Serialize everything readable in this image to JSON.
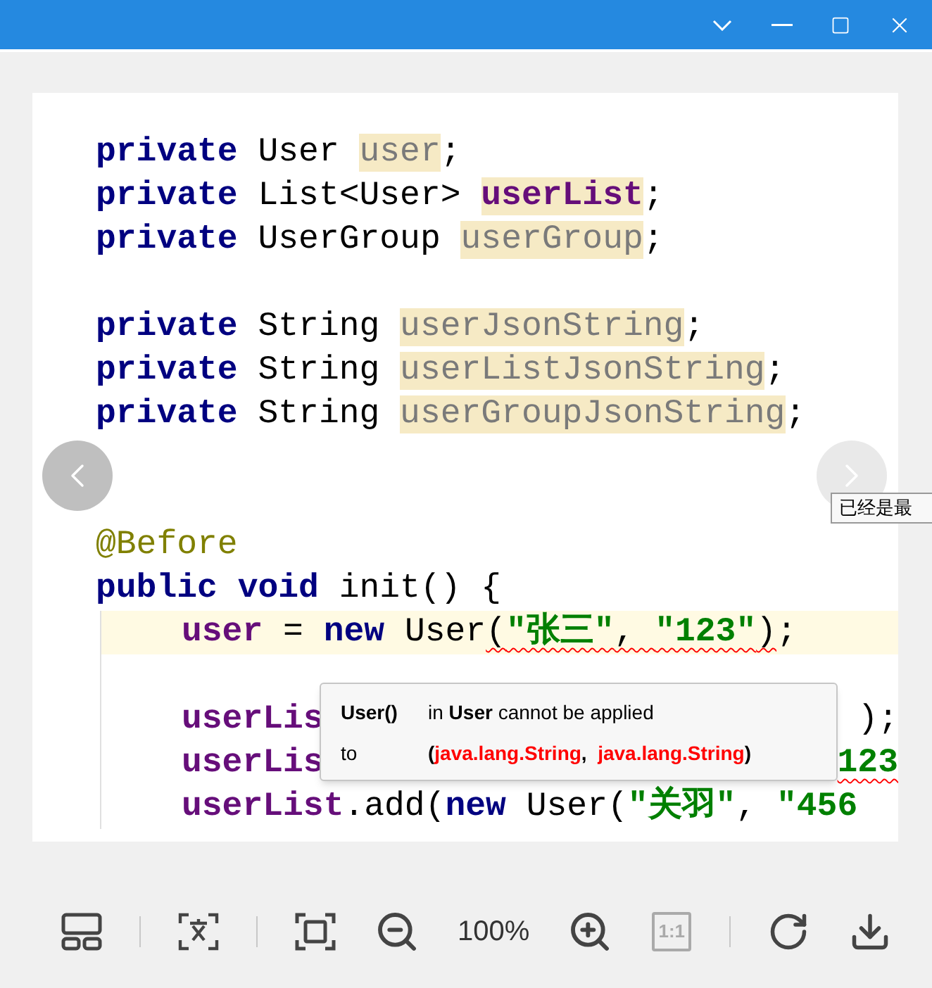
{
  "title_bar": {
    "buttons": [
      {
        "kind": "dropdown"
      },
      {
        "kind": "minimize"
      },
      {
        "kind": "maximize"
      },
      {
        "kind": "close"
      }
    ]
  },
  "code": {
    "lines": [
      {
        "tokens": [
          {
            "text": "private",
            "kind": "keyword"
          },
          {
            "text": " User ",
            "kind": "plain"
          },
          {
            "text": "user",
            "kind": "unused_field"
          },
          {
            "text": ";",
            "kind": "plain"
          }
        ]
      },
      {
        "tokens": [
          {
            "text": "private",
            "kind": "keyword"
          },
          {
            "text": " List<User> ",
            "kind": "plain"
          },
          {
            "text": "userList",
            "kind": "field_decl"
          },
          {
            "text": ";",
            "kind": "plain"
          }
        ]
      },
      {
        "tokens": [
          {
            "text": "private",
            "kind": "keyword"
          },
          {
            "text": " UserGroup ",
            "kind": "plain"
          },
          {
            "text": "userGroup",
            "kind": "unused_field"
          },
          {
            "text": ";",
            "kind": "plain"
          }
        ]
      },
      {
        "kind": "blank"
      },
      {
        "tokens": [
          {
            "text": "private",
            "kind": "keyword"
          },
          {
            "text": " String ",
            "kind": "plain"
          },
          {
            "text": "userJsonString",
            "kind": "unused_field"
          },
          {
            "text": ";",
            "kind": "plain"
          }
        ]
      },
      {
        "tokens": [
          {
            "text": "private",
            "kind": "keyword"
          },
          {
            "text": " String ",
            "kind": "plain"
          },
          {
            "text": "userListJsonString",
            "kind": "unused_field"
          },
          {
            "text": ";",
            "kind": "plain"
          }
        ]
      },
      {
        "tokens": [
          {
            "text": "private",
            "kind": "keyword"
          },
          {
            "text": " String ",
            "kind": "plain"
          },
          {
            "text": "userGroupJsonString",
            "kind": "unused_field"
          },
          {
            "text": ";",
            "kind": "plain"
          }
        ]
      },
      {
        "kind": "blank"
      },
      {
        "kind": "blank"
      },
      {
        "tokens": [
          {
            "text": "@Before",
            "kind": "annotation"
          }
        ]
      },
      {
        "tokens": [
          {
            "text": "public void",
            "kind": "keyword"
          },
          {
            "text": " init() {",
            "kind": "plain"
          }
        ],
        "children": [
          {
            "current": true,
            "tokens": [
              {
                "text": "user",
                "kind": "field"
              },
              {
                "text": " = ",
                "kind": "plain"
              },
              {
                "text": "new",
                "kind": "keyword"
              },
              {
                "text": " User",
                "kind": "plain"
              },
              {
                "text": "(",
                "kind": "plain",
                "error": true
              },
              {
                "text": "\"张三\"",
                "kind": "string",
                "error": true
              },
              {
                "text": ", ",
                "kind": "plain",
                "error": true
              },
              {
                "text": "\"123\"",
                "kind": "string",
                "error": true
              },
              {
                "text": ")",
                "kind": "plain",
                "error": true
              },
              {
                "text": ";",
                "kind": "plain"
              }
            ]
          },
          {
            "kind": "blank"
          },
          {
            "tokens": [
              {
                "text": "userLis",
                "kind": "field"
              }
            ],
            "trailing": [
              {
                "text": ");",
                "kind": "plain"
              }
            ]
          },
          {
            "tokens": [
              {
                "text": "userLis",
                "kind": "field"
              }
            ],
            "trailing": [
              {
                "text": "123",
                "kind": "string",
                "error": true
              }
            ]
          },
          {
            "tokens": [
              {
                "text": "userList",
                "kind": "field"
              },
              {
                "text": ".add(",
                "kind": "plain"
              },
              {
                "text": "new",
                "kind": "keyword"
              },
              {
                "text": " User(",
                "kind": "plain"
              },
              {
                "text": "\"关羽\"",
                "kind": "string"
              },
              {
                "text": ", ",
                "kind": "plain"
              },
              {
                "text": "\"456",
                "kind": "string"
              }
            ]
          }
        ]
      }
    ]
  },
  "error_tooltip": {
    "rows": [
      {
        "label": "User()",
        "segments": [
          {
            "text": "in ",
            "kind": "plain"
          },
          {
            "text": "User",
            "kind": "bold"
          },
          {
            "text": " cannot be applied",
            "kind": "plain"
          }
        ]
      },
      {
        "label": "to",
        "segments": [
          {
            "text": "(",
            "kind": "bold"
          },
          {
            "text": "java.lang.String",
            "kind": "error"
          },
          {
            "text": ",  ",
            "kind": "bold"
          },
          {
            "text": "java.lang.String",
            "kind": "error"
          },
          {
            "text": ")",
            "kind": "bold"
          }
        ]
      }
    ]
  },
  "nav": [
    {
      "kind": "previous",
      "disabled": false
    },
    {
      "kind": "next",
      "disabled": true
    }
  ],
  "nav_tooltip": "已经是最",
  "toolbar": [
    {
      "kind": "layout",
      "disabled": false
    },
    {
      "kind": "divider"
    },
    {
      "kind": "ocr",
      "disabled": false
    },
    {
      "kind": "divider"
    },
    {
      "kind": "fit",
      "disabled": false
    },
    {
      "kind": "zoom_out",
      "disabled": false
    },
    {
      "kind": "zoom_level",
      "text": "100%"
    },
    {
      "kind": "zoom_in",
      "disabled": false
    },
    {
      "kind": "actual_size",
      "text": "1:1",
      "disabled": true
    },
    {
      "kind": "divider"
    },
    {
      "kind": "rotate",
      "disabled": false
    },
    {
      "kind": "download",
      "disabled": false
    }
  ]
}
